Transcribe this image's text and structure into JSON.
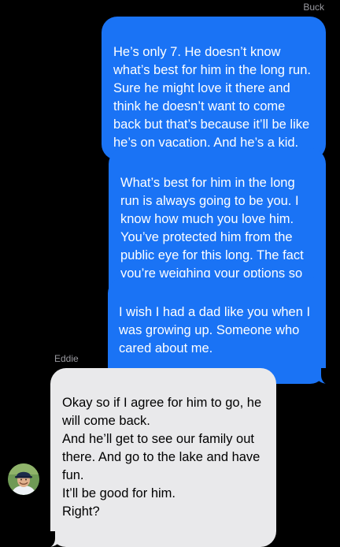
{
  "thread": {
    "top_sender": "Buck",
    "incoming_sender": "Eddie"
  },
  "messages": [
    {
      "from": "Buck",
      "text": "He’s only 7. He doesn’t know what’s best for him in the long run. Sure he might love it there and think he doesn’t want to come back but that’s because it’ll be like he’s on vacation. And he’s a kid."
    },
    {
      "from": "Buck",
      "text": "What’s best for him in the long run is always going to be you. I know how much you love him. You’ve protected him from the public eye for this long. The fact you’re weighing your options so carefully."
    },
    {
      "from": "Buck",
      "text": "I wish I had a dad like you when I was growing up. Someone who cared about me."
    },
    {
      "from": "Eddie",
      "text": "Okay so if I agree for him to go, he will come back.\nAnd he’ll get to see our family out there. And go to the lake and have fun.\nIt’ll be good for him.\nRight?"
    }
  ],
  "colors": {
    "background": "#000000",
    "outgoing_bubble": "#1a73f5",
    "incoming_bubble": "#e9e9eb",
    "sender_label": "#9a9aa0"
  },
  "icons": {
    "avatar": "contact-photo-avatar"
  }
}
